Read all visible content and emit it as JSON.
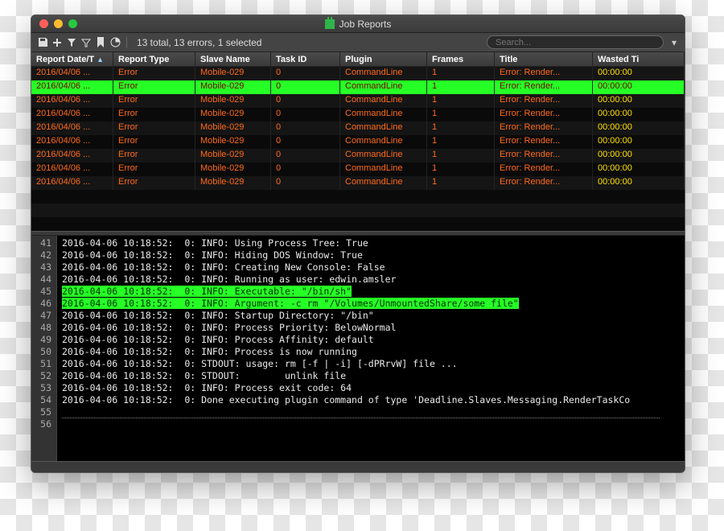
{
  "window": {
    "title": "Job Reports"
  },
  "toolbar": {
    "status": "13 total, 13 errors, 1 selected",
    "search_placeholder": "Search..."
  },
  "columns": [
    {
      "key": "date",
      "label": "Report Date/T",
      "sort": "▲"
    },
    {
      "key": "type",
      "label": "Report Type"
    },
    {
      "key": "slave",
      "label": "Slave Name"
    },
    {
      "key": "task",
      "label": "Task ID"
    },
    {
      "key": "plugin",
      "label": "Plugin"
    },
    {
      "key": "frames",
      "label": "Frames"
    },
    {
      "key": "title",
      "label": "Title"
    },
    {
      "key": "wasted",
      "label": "Wasted Ti"
    }
  ],
  "rows": [
    {
      "date": "2016/04/06 ...",
      "type": "Error",
      "slave": "Mobile-029",
      "task": "0",
      "plugin": "CommandLine",
      "frames": "1",
      "title": "Error: Render...",
      "wasted": "00:00:00",
      "selected": false
    },
    {
      "date": "2016/04/06 ...",
      "type": "Error",
      "slave": "Mobile-029",
      "task": "0",
      "plugin": "CommandLine",
      "frames": "1",
      "title": "Error: Render...",
      "wasted": "00:00:00",
      "selected": true
    },
    {
      "date": "2016/04/06 ...",
      "type": "Error",
      "slave": "Mobile-029",
      "task": "0",
      "plugin": "CommandLine",
      "frames": "1",
      "title": "Error: Render...",
      "wasted": "00:00:00",
      "selected": false
    },
    {
      "date": "2016/04/06 ...",
      "type": "Error",
      "slave": "Mobile-029",
      "task": "0",
      "plugin": "CommandLine",
      "frames": "1",
      "title": "Error: Render...",
      "wasted": "00:00:00",
      "selected": false
    },
    {
      "date": "2016/04/06 ...",
      "type": "Error",
      "slave": "Mobile-029",
      "task": "0",
      "plugin": "CommandLine",
      "frames": "1",
      "title": "Error: Render...",
      "wasted": "00:00:00",
      "selected": false
    },
    {
      "date": "2016/04/06 ...",
      "type": "Error",
      "slave": "Mobile-029",
      "task": "0",
      "plugin": "CommandLine",
      "frames": "1",
      "title": "Error: Render...",
      "wasted": "00:00:00",
      "selected": false
    },
    {
      "date": "2016/04/06 ...",
      "type": "Error",
      "slave": "Mobile-029",
      "task": "0",
      "plugin": "CommandLine",
      "frames": "1",
      "title": "Error: Render...",
      "wasted": "00:00:00",
      "selected": false
    },
    {
      "date": "2016/04/06 ...",
      "type": "Error",
      "slave": "Mobile-029",
      "task": "0",
      "plugin": "CommandLine",
      "frames": "1",
      "title": "Error: Render...",
      "wasted": "00:00:00",
      "selected": false
    },
    {
      "date": "2016/04/06 ...",
      "type": "Error",
      "slave": "Mobile-029",
      "task": "0",
      "plugin": "CommandLine",
      "frames": "1",
      "title": "Error: Render...",
      "wasted": "00:00:00",
      "selected": false
    }
  ],
  "log": {
    "start": 41,
    "lines": [
      {
        "n": 41,
        "t": "2016-04-06 10:18:52:  0: INFO: Using Process Tree: True"
      },
      {
        "n": 42,
        "t": "2016-04-06 10:18:52:  0: INFO: Hiding DOS Window: True"
      },
      {
        "n": 43,
        "t": "2016-04-06 10:18:52:  0: INFO: Creating New Console: False"
      },
      {
        "n": 44,
        "t": "2016-04-06 10:18:52:  0: INFO: Running as user: edwin.amsler"
      },
      {
        "n": 45,
        "t": "2016-04-06 10:18:52:  0: INFO: Executable: \"/bin/sh\"",
        "hl": true
      },
      {
        "n": 46,
        "t": "2016-04-06 10:18:52:  0: INFO: Argument: -c rm \"/Volumes/UnmountedShare/some file\"",
        "hl": true
      },
      {
        "n": 47,
        "t": "2016-04-06 10:18:52:  0: INFO: Startup Directory: \"/bin\""
      },
      {
        "n": 48,
        "t": "2016-04-06 10:18:52:  0: INFO: Process Priority: BelowNormal"
      },
      {
        "n": 49,
        "t": "2016-04-06 10:18:52:  0: INFO: Process Affinity: default"
      },
      {
        "n": 50,
        "t": "2016-04-06 10:18:52:  0: INFO: Process is now running"
      },
      {
        "n": 51,
        "t": "2016-04-06 10:18:52:  0: STDOUT: usage: rm [-f | -i] [-dPRrvW] file ..."
      },
      {
        "n": 52,
        "t": "2016-04-06 10:18:52:  0: STDOUT:        unlink file"
      },
      {
        "n": 53,
        "t": "2016-04-06 10:18:52:  0: INFO: Process exit code: 64"
      },
      {
        "n": 54,
        "t": "2016-04-06 10:18:52:  0: Done executing plugin command of type 'Deadline.Slaves.Messaging.RenderTaskCo"
      },
      {
        "n": 55,
        "t": ""
      },
      {
        "n": 56,
        "t": ""
      }
    ]
  }
}
